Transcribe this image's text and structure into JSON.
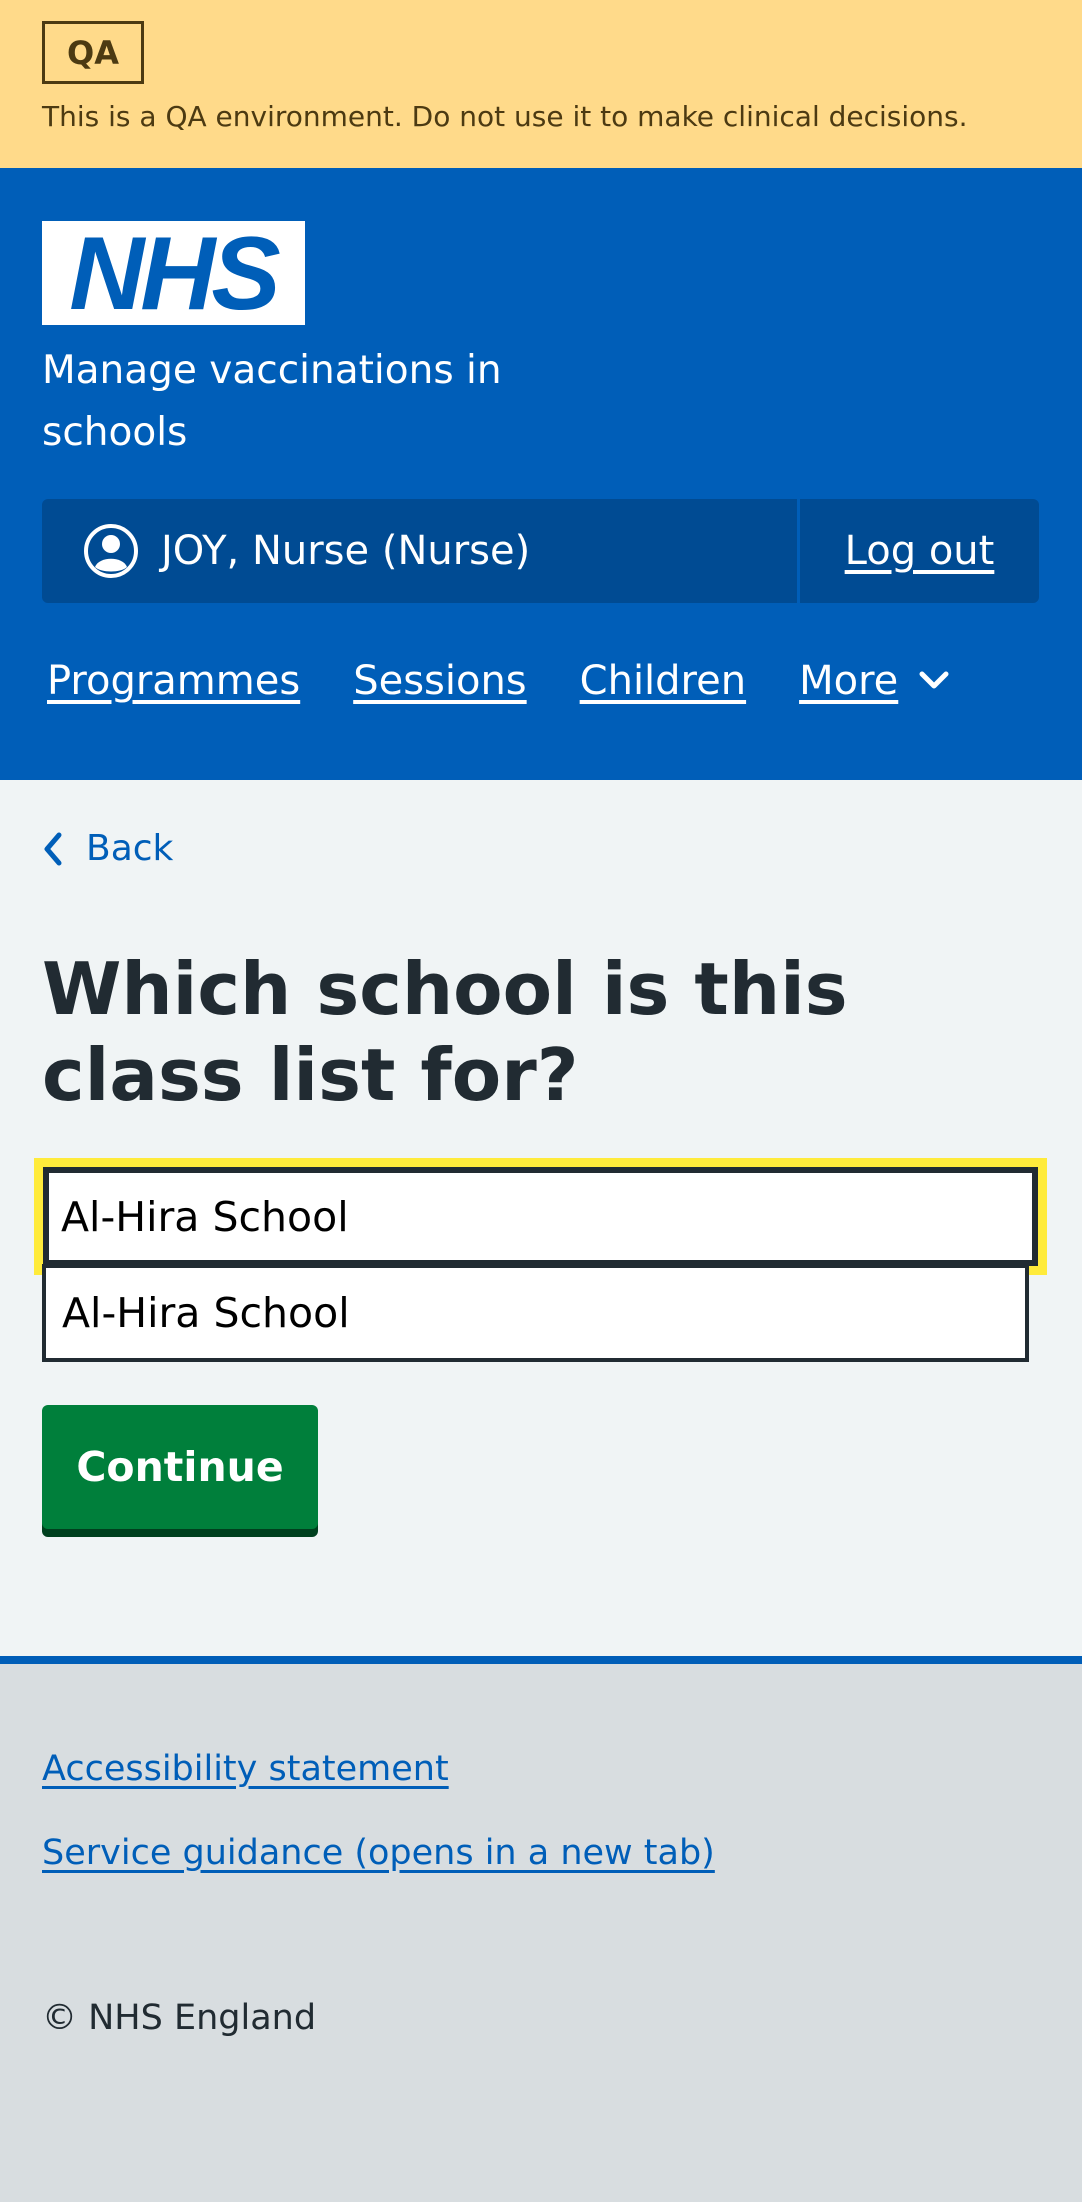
{
  "qa_banner": {
    "tag": "QA",
    "text": "This is a QA environment. Do not use it to make clinical decisions."
  },
  "header": {
    "logo_text": "NHS",
    "service_name": "Manage vaccinations in schools",
    "user": "JOY, Nurse (Nurse)",
    "logout": "Log out",
    "nav": [
      "Programmes",
      "Sessions",
      "Children"
    ],
    "more": "More"
  },
  "main": {
    "back": "Back",
    "title": "Which school is this class list for?",
    "input_value": "Al-Hira School",
    "options": [
      "Al-Hira School"
    ],
    "continue": "Continue"
  },
  "footer": {
    "accessibility": "Accessibility statement",
    "guidance": "Service guidance (opens in a new tab)",
    "copyright": "© NHS England"
  },
  "colors": {
    "nhs_blue": "#005eb8",
    "qa_yellow": "#ffda8a",
    "button_green": "#007f3b",
    "focus_yellow": "#ffeb3b"
  }
}
